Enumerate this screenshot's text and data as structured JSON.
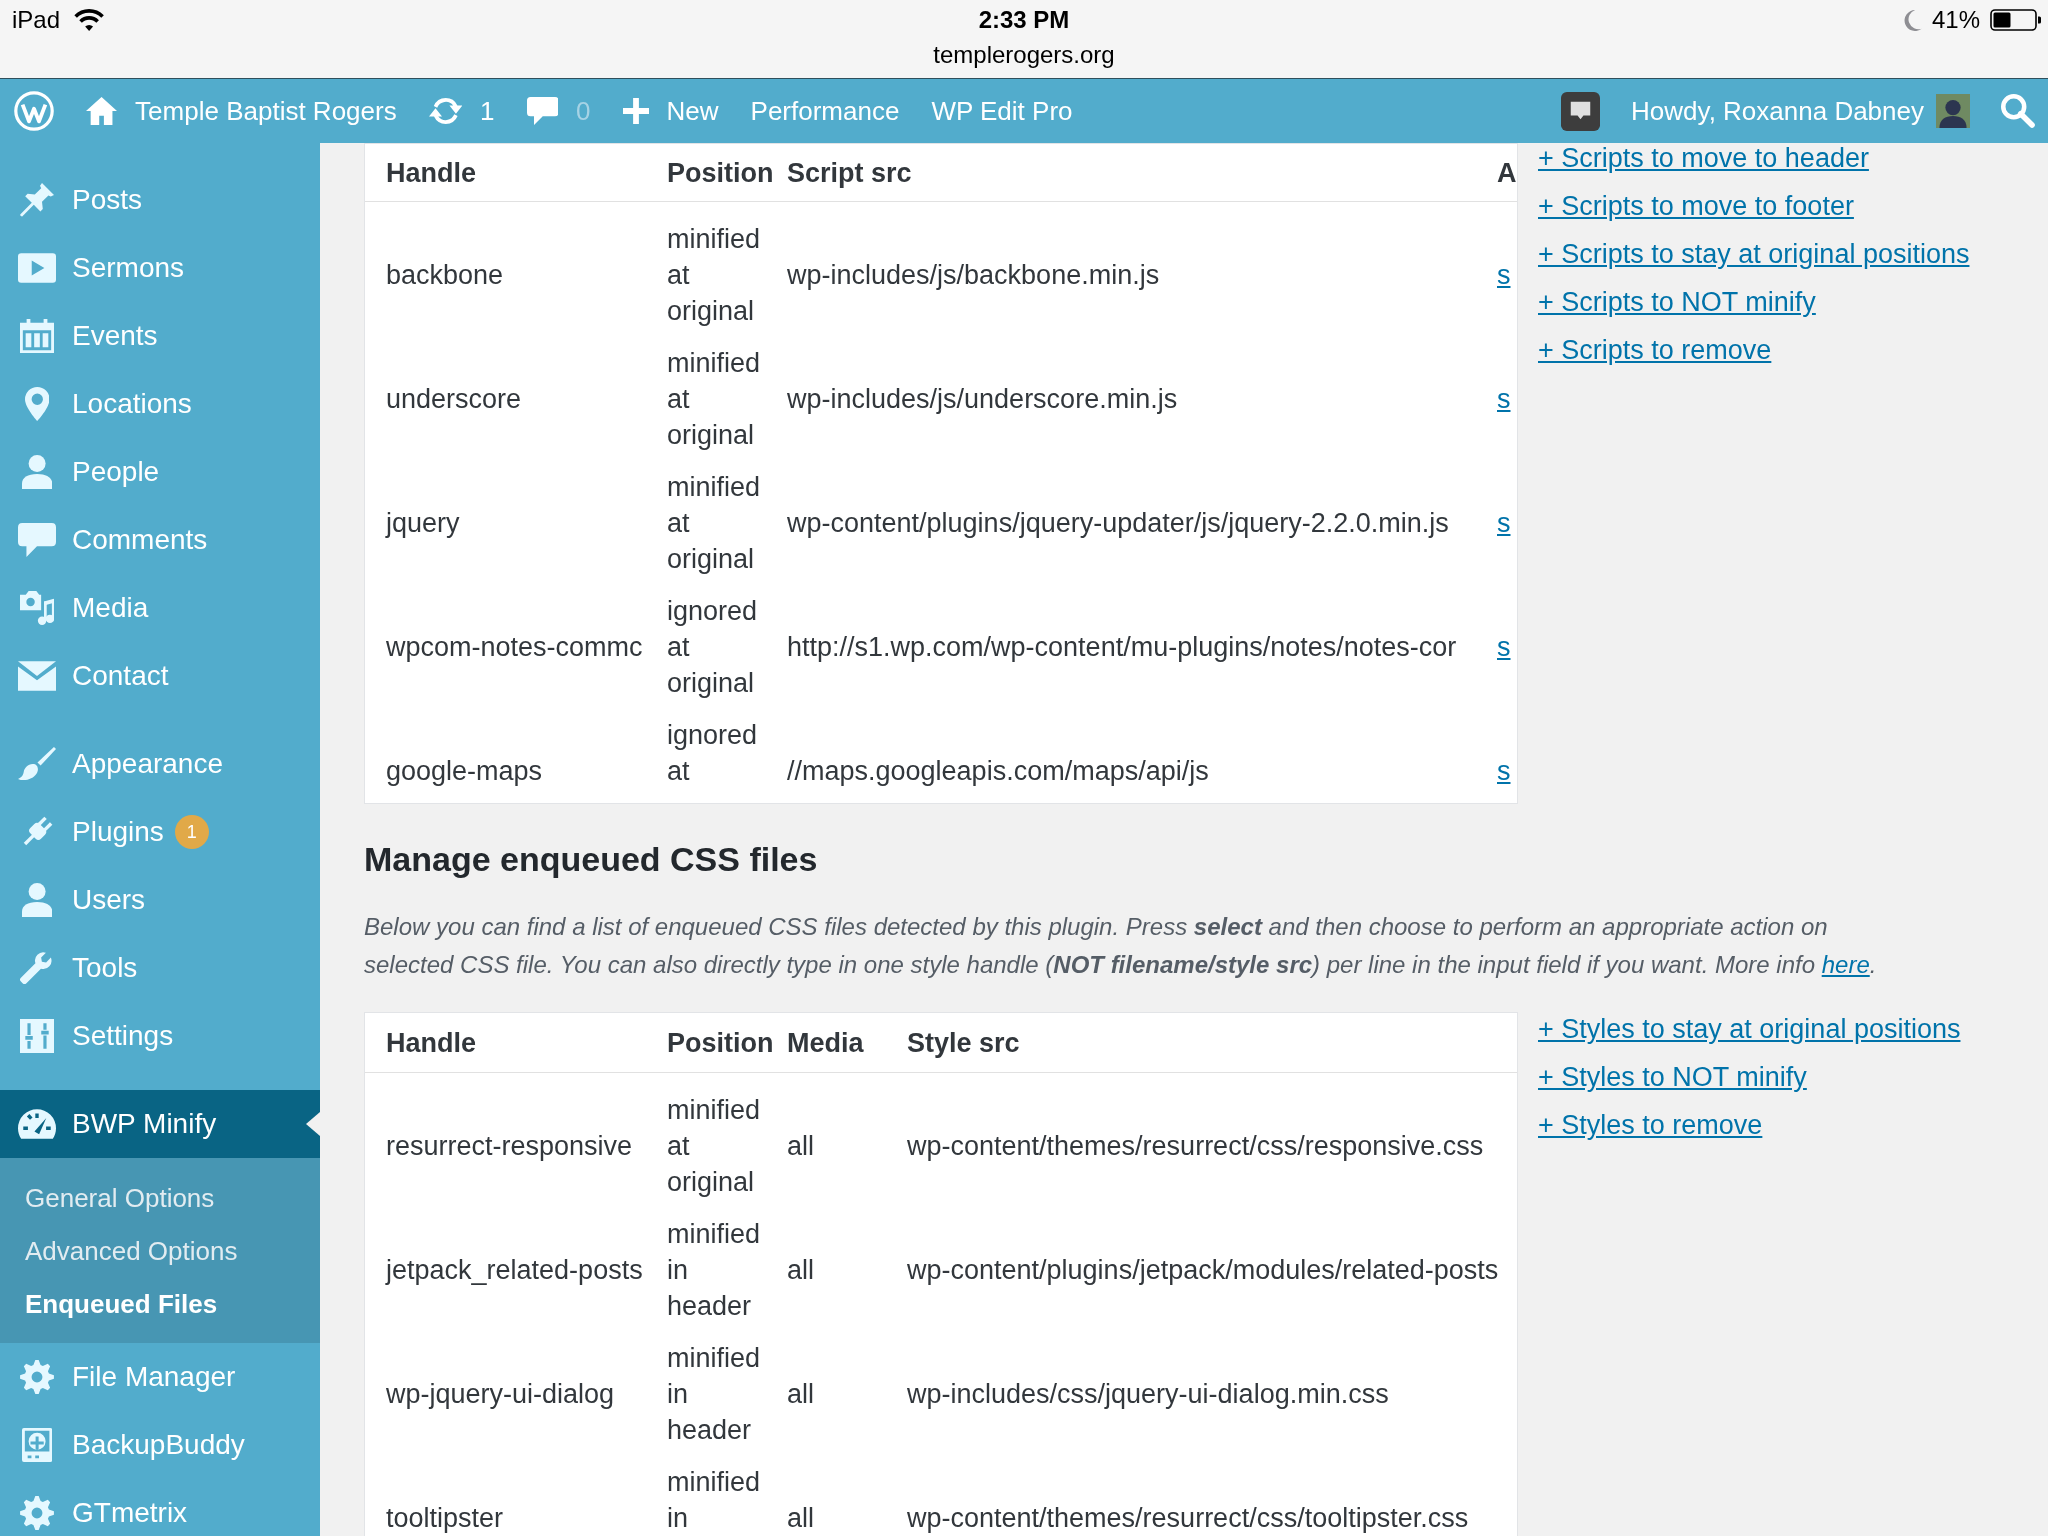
{
  "status_bar": {
    "device": "iPad",
    "time": "2:33 PM",
    "url": "templerogers.org",
    "battery": "41%"
  },
  "admin_bar": {
    "site_name": "Temple Baptist Rogers",
    "updates": "1",
    "comments": "0",
    "new_label": "New",
    "menus": [
      "Performance",
      "WP Edit Pro"
    ],
    "greeting": "Howdy, Roxanna Dabney"
  },
  "sidebar": {
    "groups": [
      {
        "items": [
          {
            "label": "Posts",
            "selected": false
          },
          {
            "label": "Sermons",
            "selected": false
          },
          {
            "label": "Events",
            "selected": false
          },
          {
            "label": "Locations",
            "selected": false
          },
          {
            "label": "People",
            "selected": false
          },
          {
            "label": "Comments",
            "selected": false
          },
          {
            "label": "Media",
            "selected": false
          },
          {
            "label": "Contact",
            "selected": false
          }
        ]
      },
      {
        "items": [
          {
            "label": "Appearance",
            "selected": false
          },
          {
            "label": "Plugins",
            "badge": "1",
            "selected": false
          },
          {
            "label": "Users",
            "selected": false
          },
          {
            "label": "Tools",
            "selected": false
          },
          {
            "label": "Settings",
            "selected": false
          }
        ]
      },
      {
        "items": [
          {
            "label": "BWP Minify",
            "selected": true,
            "children": [
              {
                "label": "General Options",
                "selected": false
              },
              {
                "label": "Advanced Options",
                "selected": false
              },
              {
                "label": "Enqueued Files",
                "selected": true
              }
            ]
          },
          {
            "label": "File Manager",
            "selected": false
          },
          {
            "label": "BackupBuddy",
            "selected": false
          },
          {
            "label": "GTmetrix",
            "selected": false
          }
        ]
      }
    ]
  },
  "scripts": {
    "columns": [
      "Handle",
      "Position",
      "Script src",
      "A"
    ],
    "rows": [
      {
        "handle": "backbone",
        "position": "minified at original",
        "script_src": "wp-includes/js/backbone.min.js",
        "column_4": "s"
      },
      {
        "handle": "underscore",
        "position": "minified at original",
        "script_src": "wp-includes/js/underscore.min.js",
        "column_4": "s"
      },
      {
        "handle": "jquery",
        "position": "minified at original",
        "script_src": "wp-content/plugins/jquery-updater/js/jquery-2.2.0.min.js",
        "column_4": "s"
      },
      {
        "handle": "wpcom-notes-commc",
        "position": "ignored at original",
        "script_src": "http://s1.wp.com/wp-content/mu-plugins/notes/notes-cor",
        "column_4": "s"
      },
      {
        "handle": "google-maps",
        "position": "ignored at",
        "script_src": "//maps.googleapis.com/maps/api/js",
        "column_4": "s"
      }
    ],
    "links": [
      "+ Scripts to move to header",
      "+ Scripts to move to footer",
      "+ Scripts to stay at original positions",
      "+ Scripts to NOT minify",
      "+ Scripts to remove"
    ]
  },
  "styles": {
    "title": "Manage enqueued CSS files",
    "description": {
      "lines": [
        "Below you can find a list of enqueued CSS files detected by this plugin. Press **select** and then choose to perform an appropriate action on",
        "selected CSS file. You can also directly type in one style handle (**NOT filename/style src**) per line in the input field if you want. More info"
      ],
      "link": "here",
      "end": "."
    },
    "columns": [
      "Handle",
      "Position",
      "Media",
      "Style src"
    ],
    "rows": [
      {
        "handle": "resurrect-responsive",
        "position": "minified at original",
        "media": "all",
        "style_src": "wp-content/themes/resurrect/css/responsive.css"
      },
      {
        "handle": "jetpack_related-posts",
        "position": "minified in header",
        "media": "all",
        "style_src": "wp-content/plugins/jetpack/modules/related-posts"
      },
      {
        "handle": "wp-jquery-ui-dialog",
        "position": "minified in header",
        "media": "all",
        "style_src": "wp-includes/css/jquery-ui-dialog.min.css"
      },
      {
        "handle": "tooltipster",
        "position": "minified in",
        "media": "all",
        "style_src": "wp-content/themes/resurrect/css/tooltipster.css"
      }
    ],
    "links": [
      "+ Styles to stay at original positions",
      "+ Styles to NOT minify",
      "+ Styles to remove"
    ]
  }
}
